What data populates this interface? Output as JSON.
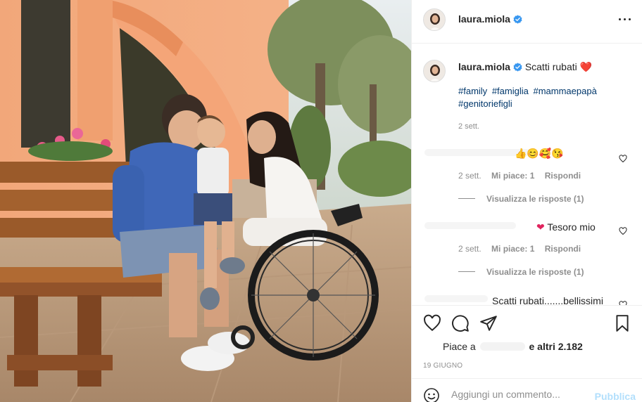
{
  "post": {
    "username": "laura.miola",
    "verified": true,
    "photo_description_icon": "photo-icon"
  },
  "caption": {
    "username": "laura.miola",
    "text": "Scatti rubati",
    "emoji": "❤️",
    "hashtags": [
      "#family",
      "#famiglia",
      "#mammaepapà",
      "#genitoriefigli"
    ],
    "time": "2 sett."
  },
  "comments": [
    {
      "text": "👍😊🥰😘",
      "time": "2 sett.",
      "likes": "Mi piace: 1",
      "reply": "Rispondi",
      "view_replies": "Visualizza le risposte (1)"
    },
    {
      "text": "Tesoro mio",
      "time": "2 sett.",
      "likes": "Mi piace: 1",
      "reply": "Rispondi",
      "view_replies": "Visualizza le risposte (1)"
    },
    {
      "text": "Scatti rubati.......bellissimi"
    }
  ],
  "actions": {
    "likes_prefix": "Piace a",
    "likes_suffix": "e altri 2.182",
    "date": "19 GIUGNO"
  },
  "add_comment": {
    "placeholder": "Aggiungi un commento...",
    "publish": "Pubblica"
  },
  "colors": {
    "link": "#00376b",
    "verified": "#3897f0",
    "publish_disabled": "#b2dffc",
    "muted": "#8e8e8e"
  }
}
